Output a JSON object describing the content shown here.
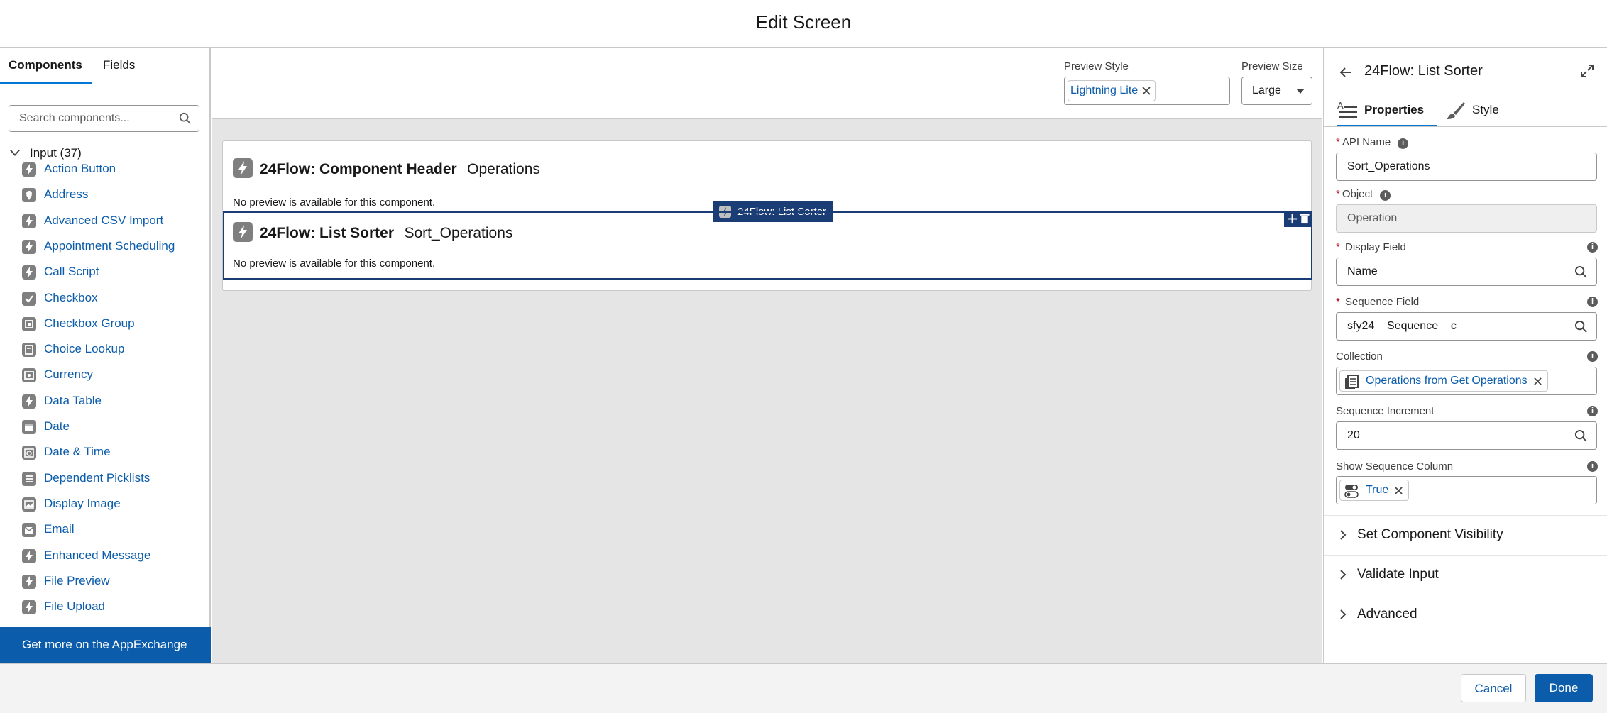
{
  "header": {
    "title": "Edit Screen"
  },
  "left_panel": {
    "tabs": [
      {
        "label": "Components",
        "active": true
      },
      {
        "label": "Fields",
        "active": false
      }
    ],
    "search": {
      "placeholder": "Search components..."
    },
    "category": {
      "label": "Input (37)",
      "expanded": true
    },
    "items": [
      {
        "label": "Action Button",
        "icon": "bolt-icon"
      },
      {
        "label": "Address",
        "icon": "location-icon"
      },
      {
        "label": "Advanced CSV Import",
        "icon": "bolt-icon"
      },
      {
        "label": "Appointment Scheduling",
        "icon": "bolt-icon"
      },
      {
        "label": "Call Script",
        "icon": "bolt-icon"
      },
      {
        "label": "Checkbox",
        "icon": "checkbox-icon"
      },
      {
        "label": "Checkbox Group",
        "icon": "checkbox-group-icon"
      },
      {
        "label": "Choice Lookup",
        "icon": "lookup-icon"
      },
      {
        "label": "Currency",
        "icon": "currency-icon"
      },
      {
        "label": "Data Table",
        "icon": "bolt-icon"
      },
      {
        "label": "Date",
        "icon": "calendar-icon"
      },
      {
        "label": "Date & Time",
        "icon": "datetime-icon"
      },
      {
        "label": "Dependent Picklists",
        "icon": "picklist-icon"
      },
      {
        "label": "Display Image",
        "icon": "image-icon"
      },
      {
        "label": "Email",
        "icon": "email-icon"
      },
      {
        "label": "Enhanced Message",
        "icon": "bolt-icon"
      },
      {
        "label": "File Preview",
        "icon": "bolt-icon"
      },
      {
        "label": "File Upload",
        "icon": "bolt-icon"
      }
    ],
    "appexchange_label": "Get more on the AppExchange"
  },
  "preview": {
    "style_label": "Preview Style",
    "style_value": "Lightning Lite",
    "size_label": "Preview Size",
    "size_value": "Large"
  },
  "canvas": {
    "components": [
      {
        "title": "24Flow: Component Header",
        "api_name": "Operations",
        "message": "No preview is available for this component."
      },
      {
        "title": "24Flow: List Sorter",
        "api_name": "Sort_Operations",
        "message": "No preview is available for this component."
      }
    ],
    "selected_tag": "24Flow: List Sorter"
  },
  "right_panel": {
    "title": "24Flow: List Sorter",
    "tabs": [
      {
        "label": "Properties",
        "active": true
      },
      {
        "label": "Style",
        "active": false
      }
    ],
    "fields": {
      "api_name": {
        "label": "API Name",
        "value": "Sort_Operations"
      },
      "object": {
        "label": "Object",
        "value": "Operation"
      },
      "display_field": {
        "label": "Display Field",
        "value": "Name"
      },
      "sequence_field": {
        "label": "Sequence Field",
        "value": "sfy24__Sequence__c"
      },
      "collection": {
        "label": "Collection",
        "value": "Operations from Get Operations"
      },
      "sequence_increment": {
        "label": "Sequence Increment",
        "value": "20"
      },
      "show_sequence_column": {
        "label": "Show Sequence Column",
        "value": "True"
      }
    },
    "sections": [
      {
        "label": "Set Component Visibility"
      },
      {
        "label": "Validate Input"
      },
      {
        "label": "Advanced"
      }
    ]
  },
  "footer": {
    "cancel_label": "Cancel",
    "done_label": "Done"
  },
  "colors": {
    "brand": "#0b5cab",
    "selected_outline": "#1b3d76",
    "required": "#ba0517"
  }
}
